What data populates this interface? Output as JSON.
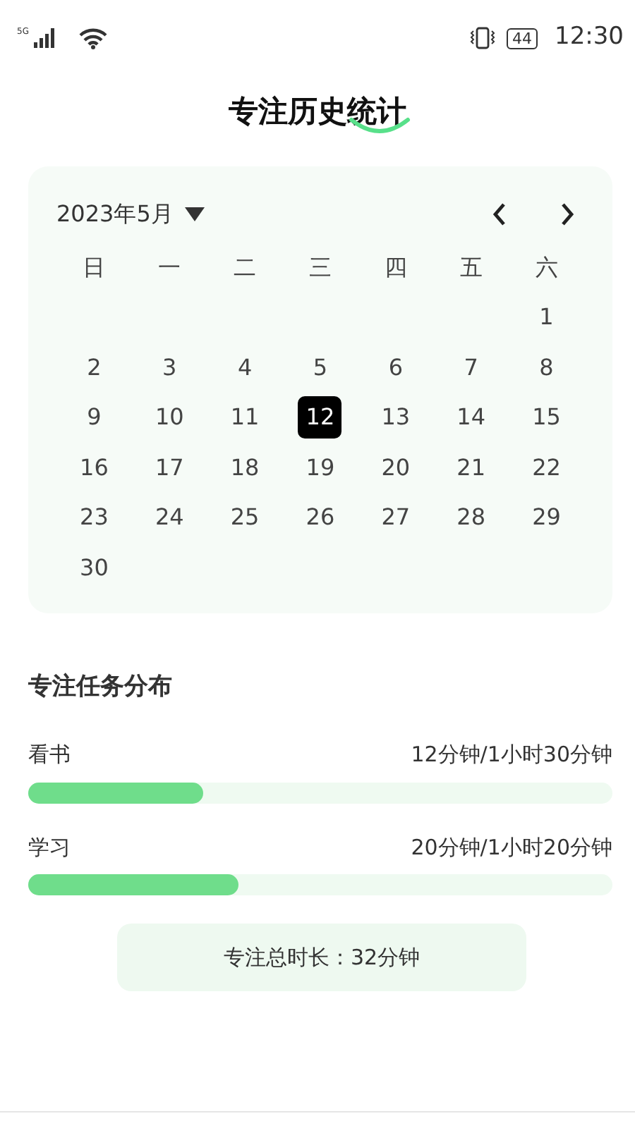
{
  "status_bar": {
    "network": "5G",
    "battery": "44",
    "time": "12:30"
  },
  "title": "专注历史统计",
  "calendar": {
    "month": "2023年5月",
    "weekdays": [
      "日",
      "一",
      "二",
      "三",
      "四",
      "五",
      "六"
    ],
    "weeks": [
      {
        "kind": "first",
        "days": [
          {
            "label": "1",
            "selected": false
          }
        ]
      },
      {
        "kind": "full",
        "days": [
          {
            "label": "2",
            "selected": false
          },
          {
            "label": "3",
            "selected": false
          },
          {
            "label": "4",
            "selected": false
          },
          {
            "label": "5",
            "selected": false
          },
          {
            "label": "6",
            "selected": false
          },
          {
            "label": "7",
            "selected": false
          },
          {
            "label": "8",
            "selected": false
          }
        ]
      },
      {
        "kind": "full",
        "days": [
          {
            "label": "9",
            "selected": false
          },
          {
            "label": "10",
            "selected": false
          },
          {
            "label": "11",
            "selected": false
          },
          {
            "label": "12",
            "selected": true
          },
          {
            "label": "13",
            "selected": false
          },
          {
            "label": "14",
            "selected": false
          },
          {
            "label": "15",
            "selected": false
          }
        ]
      },
      {
        "kind": "full",
        "days": [
          {
            "label": "16",
            "selected": false
          },
          {
            "label": "17",
            "selected": false
          },
          {
            "label": "18",
            "selected": false
          },
          {
            "label": "19",
            "selected": false
          },
          {
            "label": "20",
            "selected": false
          },
          {
            "label": "21",
            "selected": false
          },
          {
            "label": "22",
            "selected": false
          }
        ]
      },
      {
        "kind": "full",
        "days": [
          {
            "label": "23",
            "selected": false
          },
          {
            "label": "24",
            "selected": false
          },
          {
            "label": "25",
            "selected": false
          },
          {
            "label": "26",
            "selected": false
          },
          {
            "label": "27",
            "selected": false
          },
          {
            "label": "28",
            "selected": false
          },
          {
            "label": "29",
            "selected": false
          }
        ]
      },
      {
        "kind": "last",
        "days": [
          {
            "label": "30",
            "selected": false
          }
        ]
      }
    ]
  },
  "distribution": {
    "title": "专注任务分布",
    "tasks": [
      {
        "name": "看书",
        "reading": "12分钟/1小时30分钟",
        "level": 0.3
      },
      {
        "name": "学习",
        "reading": "20分钟/1小时20分钟",
        "level": 0.36
      }
    ]
  },
  "total": "专注总时长：32分钟"
}
